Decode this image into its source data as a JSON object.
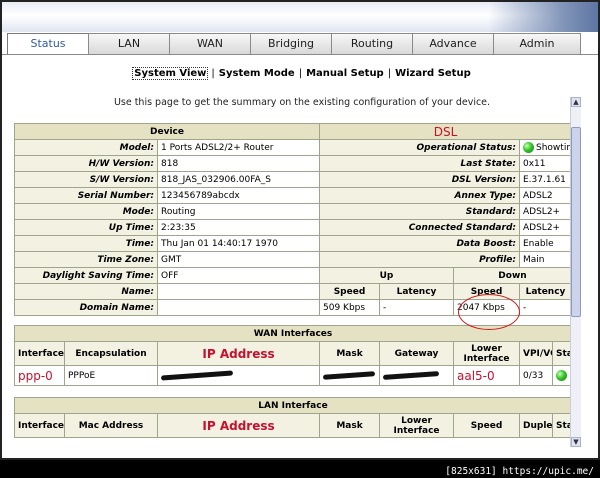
{
  "tabs": [
    {
      "label": "Status",
      "active": true
    },
    {
      "label": "LAN"
    },
    {
      "label": "WAN"
    },
    {
      "label": "Bridging"
    },
    {
      "label": "Routing"
    },
    {
      "label": "Advance"
    },
    {
      "label": "Admin"
    }
  ],
  "subnav": [
    "System View",
    "System Mode",
    "Manual Setup",
    "Wizard Setup"
  ],
  "intro": "Use this page to get the summary on the existing configuration of your device.",
  "device": {
    "header": "Device",
    "rows": [
      {
        "label": "Model:",
        "value": "1 Ports ADSL2/2+ Router"
      },
      {
        "label": "H/W Version:",
        "value": "818"
      },
      {
        "label": "S/W Version:",
        "value": "818_JAS_032906.00FA_S"
      },
      {
        "label": "Serial Number:",
        "value": "123456789abcdx"
      },
      {
        "label": "Mode:",
        "value": "Routing"
      },
      {
        "label": "Up Time:",
        "value": "2:23:35"
      },
      {
        "label": "Time:",
        "value": "Thu Jan 01 14:40:17 1970"
      },
      {
        "label": "Time Zone:",
        "value": "GMT"
      },
      {
        "label": "Daylight Saving Time:",
        "value": "OFF"
      },
      {
        "label": "Name:",
        "value": ""
      },
      {
        "label": "Domain Name:",
        "value": ""
      }
    ]
  },
  "dsl": {
    "header": "DSL",
    "rows": [
      {
        "label": "Operational Status:",
        "value": "Showtime/Data"
      },
      {
        "label": "Last State:",
        "value": "0x11"
      },
      {
        "label": "DSL Version:",
        "value": "E.37.1.61"
      },
      {
        "label": "Annex Type:",
        "value": "ADSL2"
      },
      {
        "label": "Standard:",
        "value": "ADSL2+"
      },
      {
        "label": "Connected Standard:",
        "value": "ADSL2+"
      },
      {
        "label": "Data Boost:",
        "value": "Enable"
      },
      {
        "label": "Profile:",
        "value": "Main"
      }
    ],
    "up_label": "Up",
    "down_label": "Down",
    "speed_label": "Speed",
    "latency_label": "Latency",
    "up_speed": "509 Kbps",
    "up_latency": "-",
    "down_speed": "2047 Kbps",
    "down_latency": "-"
  },
  "wan": {
    "header": "WAN Interfaces",
    "columns": [
      "Interface",
      "Encapsulation",
      "IP Address",
      "Mask",
      "Gateway",
      "Lower Interface",
      "VPI/VCI",
      "Status"
    ],
    "row": {
      "interface": "ppp-0",
      "encapsulation": "PPPoE",
      "lower_interface": "aal5-0",
      "vpi_vci": "0/33"
    }
  },
  "lan": {
    "header": "LAN Interface",
    "columns": [
      "Interface",
      "Mac Address",
      "IP Address",
      "Mask",
      "Lower Interface",
      "Speed",
      "Duplex",
      "Status"
    ]
  },
  "footer": "[825x631] https://upic.me/"
}
